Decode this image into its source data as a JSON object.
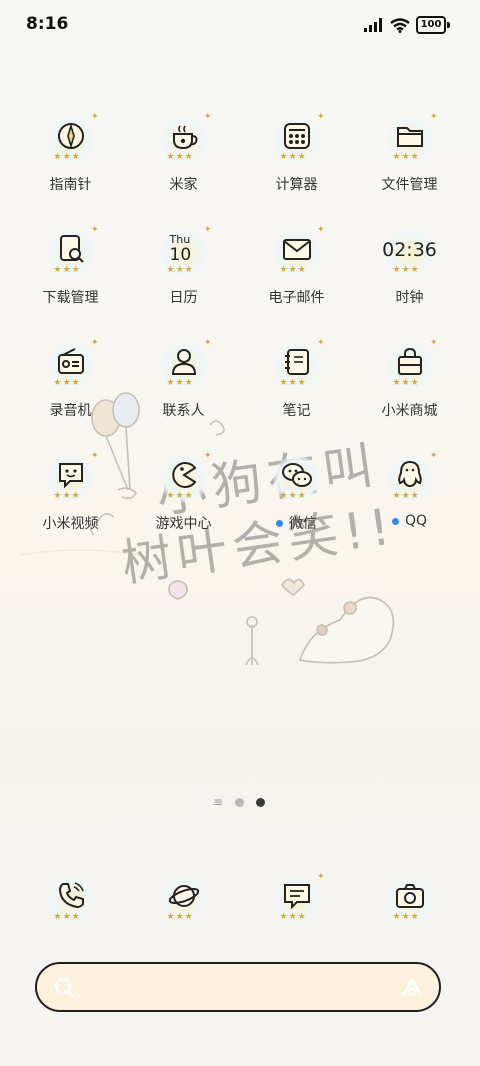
{
  "status_bar": {
    "time": "8:16",
    "battery": "100"
  },
  "apps": [
    {
      "label": "指南针",
      "icon": "compass-icon"
    },
    {
      "label": "米家",
      "icon": "coffee-cup-icon"
    },
    {
      "label": "计算器",
      "icon": "calculator-icon"
    },
    {
      "label": "文件管理",
      "icon": "folder-icon"
    },
    {
      "label": "下载管理",
      "icon": "download-search-icon"
    },
    {
      "label": "日历",
      "icon": "calendar-icon",
      "day": "Thu",
      "date": "10"
    },
    {
      "label": "电子邮件",
      "icon": "mail-icon"
    },
    {
      "label": "时钟",
      "icon": "clock-icon",
      "time": "02:36"
    },
    {
      "label": "录音机",
      "icon": "radio-recorder-icon"
    },
    {
      "label": "联系人",
      "icon": "person-icon"
    },
    {
      "label": "笔记",
      "icon": "notebook-icon"
    },
    {
      "label": "小米商城",
      "icon": "shopping-bag-icon"
    },
    {
      "label": "小米视频",
      "icon": "video-chat-icon"
    },
    {
      "label": "游戏中心",
      "icon": "pacman-icon"
    },
    {
      "label": "微信",
      "icon": "wechat-icon",
      "badge": true
    },
    {
      "label": "QQ",
      "icon": "penguin-icon",
      "badge": true
    }
  ],
  "wallpaper": {
    "text_line1": "小狗在叫",
    "text_line2": "树叶会笑!!"
  },
  "dock": [
    {
      "icon": "phone-icon"
    },
    {
      "icon": "planet-browser-icon"
    },
    {
      "icon": "message-icon"
    },
    {
      "icon": "camera-icon"
    }
  ],
  "colors": {
    "accent_star": "#d6a93a",
    "badge_dot": "#3a86e8",
    "search_bg": "#fdf1dd"
  }
}
